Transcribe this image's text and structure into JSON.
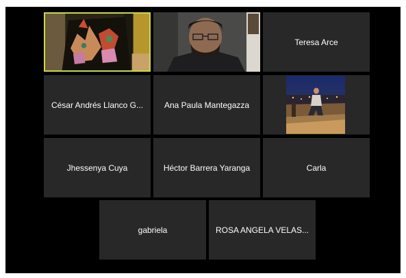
{
  "participants": [
    {
      "name": "",
      "video": "embroidery-video",
      "active": true
    },
    {
      "name": "",
      "video": "man-glasses-video"
    },
    {
      "name": "Teresa Arce"
    },
    {
      "name": "César Andrés Llanco G..."
    },
    {
      "name": "Ana Paula Mantegazza"
    },
    {
      "name": "",
      "video": "night-city-photo"
    },
    {
      "name": "Jhessenya Cuya"
    },
    {
      "name": "Héctor Barrera Yaranga"
    },
    {
      "name": "Carla"
    },
    {
      "name": "gabriela"
    },
    {
      "name": "ROSA ANGELA VELAS..."
    }
  ],
  "colors": {
    "background": "#000000",
    "tile": "#282828",
    "active_speaker_border": "#c9d94a",
    "name_text": "#ffffff"
  }
}
